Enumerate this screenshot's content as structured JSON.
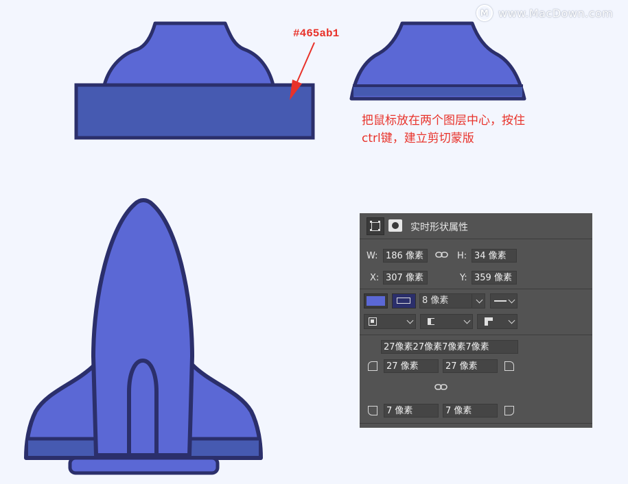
{
  "watermark": {
    "text": "www.MacDown.com",
    "logo_letter": "M"
  },
  "annotations": {
    "hex_label": "#465ab1",
    "instruction_line1": "把鼠标放在两个图层中心，按住",
    "instruction_line2": "ctrl键，建立剪切蒙版"
  },
  "colors": {
    "fill_main": "#5b68d5",
    "fill_dark": "#465ab1",
    "stroke": "#2b2f6b",
    "annotation_red": "#e8322a",
    "panel_bg": "#535353"
  },
  "properties_panel": {
    "title": "实时形状属性",
    "w_label": "W:",
    "w_value": "186 像素",
    "h_label": "H:",
    "h_value": "34 像素",
    "x_label": "X:",
    "x_value": "307 像素",
    "y_label": "Y:",
    "y_value": "359 像素",
    "stroke_width": "8 像素",
    "radii_summary": "27像素27像素7像素7像素",
    "radius_tl": "27 像素",
    "radius_tr": "27 像素",
    "radius_bl": "7 像素",
    "radius_br": "7 像素"
  }
}
